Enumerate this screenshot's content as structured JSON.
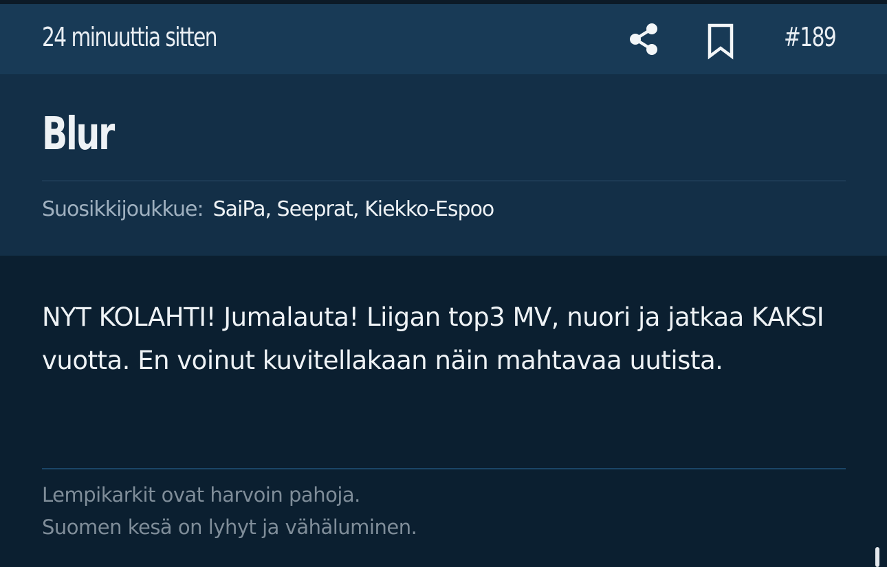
{
  "post": {
    "time_ago": "24 minuuttia sitten",
    "number": "#189",
    "icons": {
      "share": "share-icon",
      "bookmark": "bookmark-icon"
    }
  },
  "author": {
    "name": "Blur",
    "favorite_label": "Suosikkijoukkue:",
    "favorite_teams": "SaiPa, Seeprat, Kiekko-Espoo"
  },
  "body": {
    "text": "NYT KOLAHTI! Jumalauta! Liigan top3 MV, nuori ja jatkaa KAKSI vuotta. En voinut kuvitellakaan näin mahtavaa uutista."
  },
  "signature": {
    "line1": "Lempikarkit ovat harvoin pahoja.",
    "line2": "Suomen kesä on lyhyt ja vähäluminen."
  },
  "colors": {
    "page_background": "#0b1f30",
    "meta_bar": "#183a56",
    "author_panel": "#132f47",
    "text_primary": "#eef2f5",
    "text_muted": "#9fb0bf",
    "signature_text": "#7f8d99",
    "signature_divider": "#1b4567"
  }
}
